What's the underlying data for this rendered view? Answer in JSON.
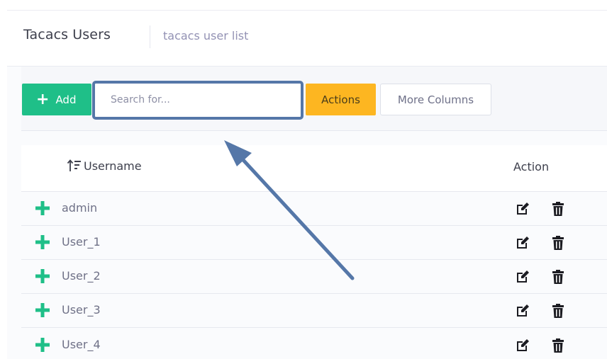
{
  "header": {
    "title": "Tacacs Users",
    "description": "tacacs user list"
  },
  "toolbar": {
    "add_label": "Add",
    "search_placeholder": "Search for...",
    "actions_label": "Actions",
    "more_columns_label": "More Columns"
  },
  "table": {
    "columns": [
      "Username",
      "Action"
    ],
    "rows": [
      {
        "username": "admin"
      },
      {
        "username": "User_1"
      },
      {
        "username": "User_2"
      },
      {
        "username": "User_3"
      },
      {
        "username": "User_4"
      }
    ]
  },
  "icons": {
    "add": "plus-icon",
    "sort": "sort-icon",
    "expand": "plus-icon",
    "edit": "edit-icon",
    "delete": "trash-icon"
  },
  "colors": {
    "add_button": "#1fbf88",
    "actions_button": "#fdb621",
    "annotation": "#5577a8",
    "title_text": "#3d3f4c",
    "muted_text": "#9392b4",
    "row_text": "#6f7187"
  }
}
